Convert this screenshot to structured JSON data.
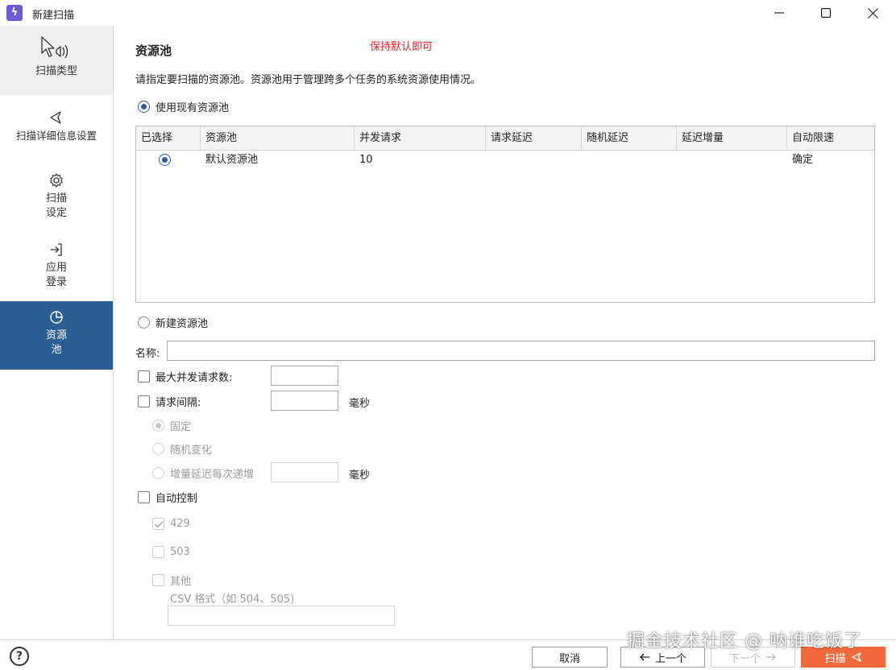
{
  "window": {
    "title": "新建扫描",
    "app_icon_glyph": "ϟ"
  },
  "sidebar": {
    "items": [
      {
        "label": "扫描类型",
        "icon": "cursor-speaker-icon"
      },
      {
        "label": "扫描详细信息设置",
        "icon": "send-icon"
      },
      {
        "label_line1": "扫描",
        "label_line2": "设定",
        "icon": "gear-icon"
      },
      {
        "label_line1": "应用",
        "label_line2": "登录",
        "icon": "login-icon"
      },
      {
        "label_line1": "资源",
        "label_line2": "池",
        "icon": "pie-chart-icon"
      }
    ]
  },
  "main": {
    "title": "资源池",
    "note": "保持默认即可",
    "description": "请指定要扫描的资源池。资源池用于管理跨多个任务的系统资源使用情况。",
    "use_existing_label": "使用现有资源池",
    "table": {
      "headers": [
        "已选择",
        "资源池",
        "并发请求",
        "请求延迟",
        "随机延迟",
        "延迟增量",
        "自动限速"
      ],
      "rows": [
        {
          "pool": "默认资源池",
          "concurrent": "10",
          "request_delay": "",
          "random_delay": "",
          "delay_increment": "",
          "auto_throttle": "确定"
        }
      ]
    },
    "new_pool_label": "新建资源池",
    "name_label": "名称:",
    "name_value": "",
    "max_concurrent_label": "最大并发请求数:",
    "max_concurrent_value": "",
    "request_interval_label": "请求间隔:",
    "request_interval_value": "",
    "ms_unit": "毫秒",
    "interval_fixed": "固定",
    "interval_random": "随机变化",
    "interval_increment": "增量延迟每次递增",
    "increment_value": "",
    "auto_control_label": "自动控制",
    "code_429": "429",
    "code_503": "503",
    "code_other": "其他",
    "csv_hint": "CSV 格式（如 504、505)",
    "csv_value": ""
  },
  "footer": {
    "help": "?",
    "cancel": "取消",
    "prev": "上一个",
    "next": "下一个",
    "scan": "扫描",
    "watermark": "掘金技术社区 @ 呐谁吃饭了"
  },
  "colors": {
    "accent": "#2a5d96",
    "note_red": "#e0252c",
    "primary_button": "#f26a3c"
  }
}
